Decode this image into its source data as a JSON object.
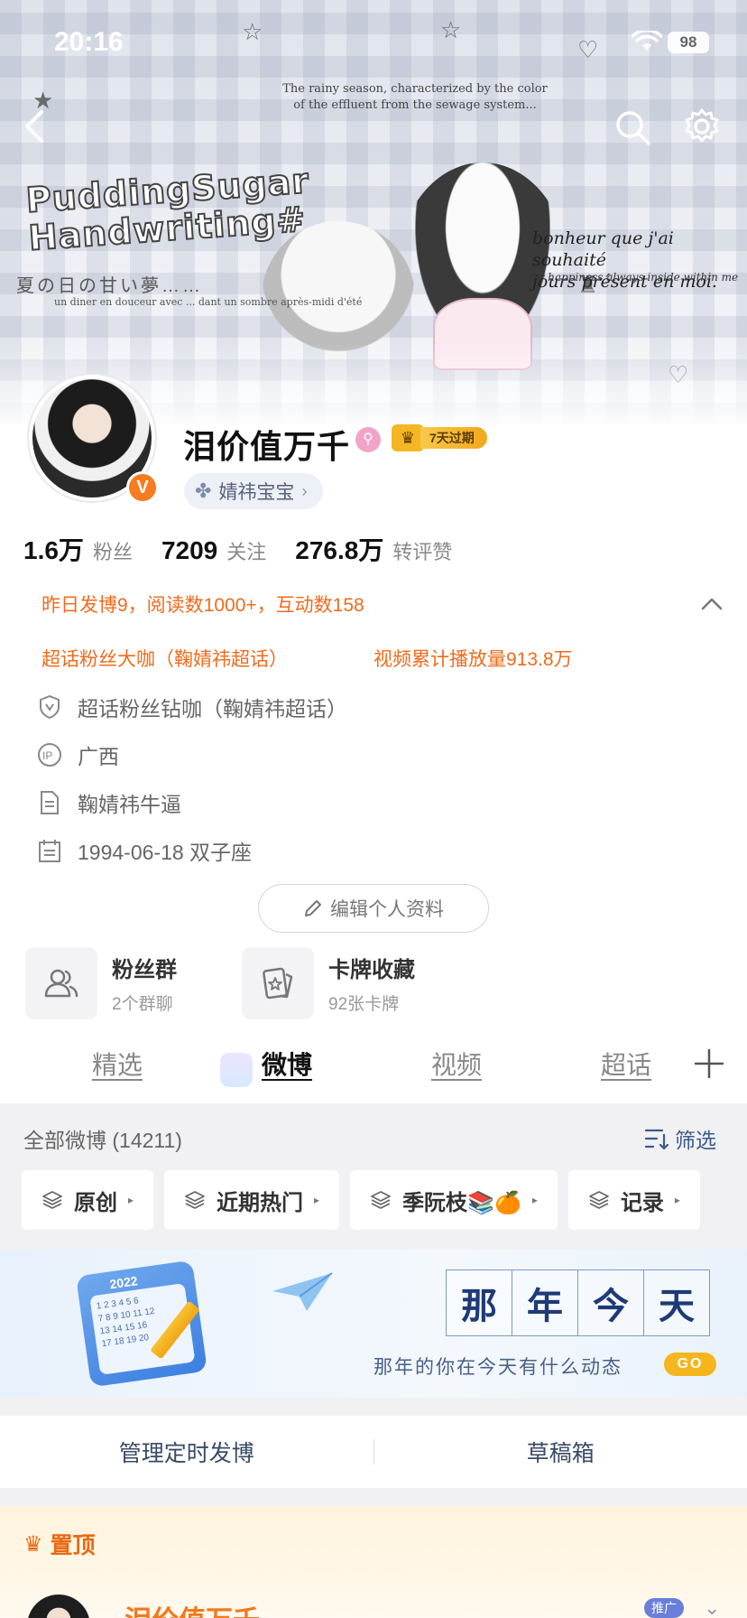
{
  "status_bar": {
    "time": "20:16",
    "battery": "98"
  },
  "banner": {
    "logo_line1": "PuddingSugar",
    "logo_line2": "Handwriting#",
    "caption_top_1": "The rainy season, characterized by the color",
    "caption_top_2": "of the effluent from the sewage system...",
    "caption_right_1": "bonheur que j'ai souhaité",
    "caption_right_2": "jours présent en moi.",
    "caption_right_3": "for happiness always inside within me",
    "caption_left_jp": "夏の日の甘い夢……",
    "caption_left_fr": "un diner en douceur avec ... dant un sombre après-midi d'été"
  },
  "profile": {
    "username": "泪价值万千",
    "vip_label": "7天过期",
    "verified_mark": "V",
    "supertopic_tag": "婧祎宝宝",
    "counts": [
      {
        "num": "1.6万",
        "label": "粉丝"
      },
      {
        "num": "7209",
        "label": "关注"
      },
      {
        "num": "276.8万",
        "label": "转评赞"
      }
    ],
    "highlights": {
      "yesterday": "昨日发博9，阅读数1000+，互动数158",
      "supertopic_fan": "超话粉丝大咖（鞠婧祎超话）",
      "video_plays": "视频累计播放量913.8万"
    },
    "info": [
      {
        "icon": "shield-v-icon",
        "text": "超话粉丝钻咖（鞠婧祎超话）"
      },
      {
        "icon": "ip-location-icon",
        "text": "广西"
      },
      {
        "icon": "document-icon",
        "text": "鞠婧祎牛逼"
      },
      {
        "icon": "calendar-icon",
        "text": "1994-06-18 双子座"
      }
    ],
    "edit_label": "编辑个人资料"
  },
  "cards": [
    {
      "title": "粉丝群",
      "sub": "2个群聊"
    },
    {
      "title": "卡牌收藏",
      "sub": "92张卡牌"
    }
  ],
  "tabs": [
    "精选",
    "微博",
    "视频",
    "超话"
  ],
  "feed": {
    "all_label": "全部微博 (14211)",
    "filter_label": "筛选",
    "chips": [
      "原创",
      "近期热门",
      "季阮枝📚🍊",
      "记录"
    ]
  },
  "memory": {
    "title_chars": [
      "那",
      "年",
      "今",
      "天"
    ],
    "subtitle": "那年的你在今天有什么动态",
    "go_label": "GO",
    "calendar_year": "2022"
  },
  "manage": {
    "scheduled": "管理定时发博",
    "drafts": "草稿箱"
  },
  "pinned": {
    "label": "置顶",
    "name": "泪价值万千",
    "promo": "推广"
  },
  "colors": {
    "accent_orange": "#f06b1c",
    "link_blue": "#3d5a88",
    "vip_gold": "#f4b622"
  }
}
